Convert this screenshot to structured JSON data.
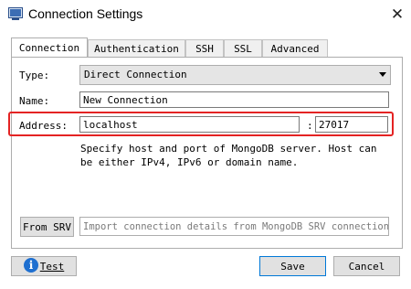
{
  "window": {
    "title": "Connection Settings",
    "close_symbol": "✕"
  },
  "tabs": [
    {
      "label": "Connection",
      "active": true
    },
    {
      "label": "Authentication",
      "active": false
    },
    {
      "label": "SSH",
      "active": false
    },
    {
      "label": "SSL",
      "active": false
    },
    {
      "label": "Advanced",
      "active": false
    }
  ],
  "form": {
    "type_label": "Type:",
    "type_value": "Direct Connection",
    "name_label": "Name:",
    "name_value": "New Connection",
    "address_label": "Address:",
    "host_value": "localhost",
    "port_separator": ":",
    "port_value": "27017",
    "help_text": "Specify host and port of MongoDB server. Host can be either IPv4, IPv6 or domain name."
  },
  "srv": {
    "button_label": "From SRV",
    "placeholder": "Import connection details from MongoDB SRV connection…"
  },
  "buttons": {
    "test_label": "Test",
    "save_label": "Save",
    "cancel_label": "Cancel"
  },
  "colors": {
    "highlight": "#e42323",
    "primary_border": "#0078d7",
    "info_icon": "#1e6fd0"
  }
}
